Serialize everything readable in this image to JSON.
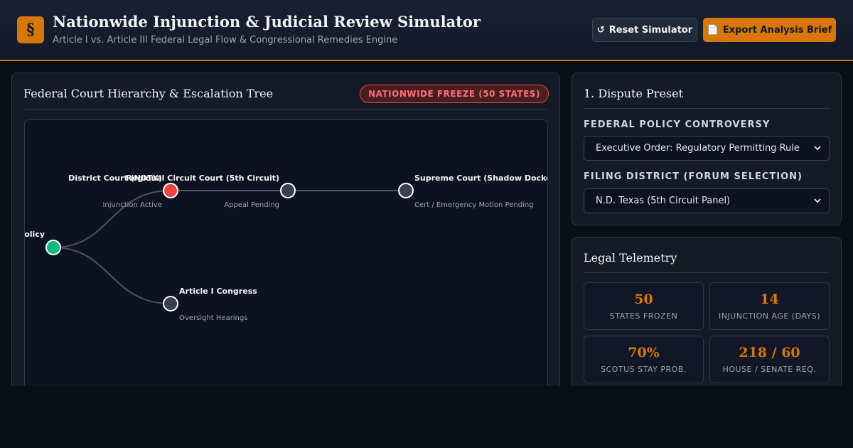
{
  "header": {
    "logo_glyph": "§",
    "title": "Nationwide Injunction & Judicial Review Simulator",
    "subtitle": "Article I vs. Article III Federal Legal Flow & Congressional Remedies Engine",
    "reset_icon": "↺",
    "reset_label": "Reset Simulator",
    "export_icon": "📄",
    "export_label": "Export Analysis Brief"
  },
  "hierarchy": {
    "title": "Federal Court Hierarchy & Escalation Tree",
    "badge": "NATIONWIDE FREEZE (50 STATES)",
    "nodes": [
      {
        "label": "Policy",
        "sublabel": "",
        "color": "#10b981"
      },
      {
        "label": "District Court (NDTX)",
        "sublabel": "Injunction Active",
        "color": "#ef4444"
      },
      {
        "label": "Regional Circuit Court (5th Circuit)",
        "sublabel": "Appeal Pending",
        "color": "#374151"
      },
      {
        "label": "Supreme Court (Shadow Docket)",
        "sublabel": "Cert / Emergency Motion Pending",
        "color": "#374151"
      },
      {
        "label": "Article I Congress",
        "sublabel": "Oversight Hearings",
        "color": "#374151"
      }
    ]
  },
  "preset": {
    "title": "1. Dispute Preset",
    "controversy_label": "FEDERAL POLICY CONTROVERSY",
    "controversy_value": "Executive Order: Regulatory Permitting Rule",
    "district_label": "FILING DISTRICT (FORUM SELECTION)",
    "district_value": "N.D. Texas (5th Circuit Panel)"
  },
  "telemetry": {
    "title": "Legal Telemetry",
    "metrics": [
      {
        "value": "50",
        "label": "STATES FROZEN"
      },
      {
        "value": "14",
        "label": "INJUNCTION AGE (DAYS)"
      },
      {
        "value": "70%",
        "label": "SCOTUS STAY PROB."
      },
      {
        "value": "218 / 60",
        "label": "HOUSE / SENATE REQ."
      }
    ]
  },
  "colors": {
    "accent": "#d97706",
    "active": "#ef4444",
    "origin": "#10b981",
    "pending": "#374151"
  }
}
